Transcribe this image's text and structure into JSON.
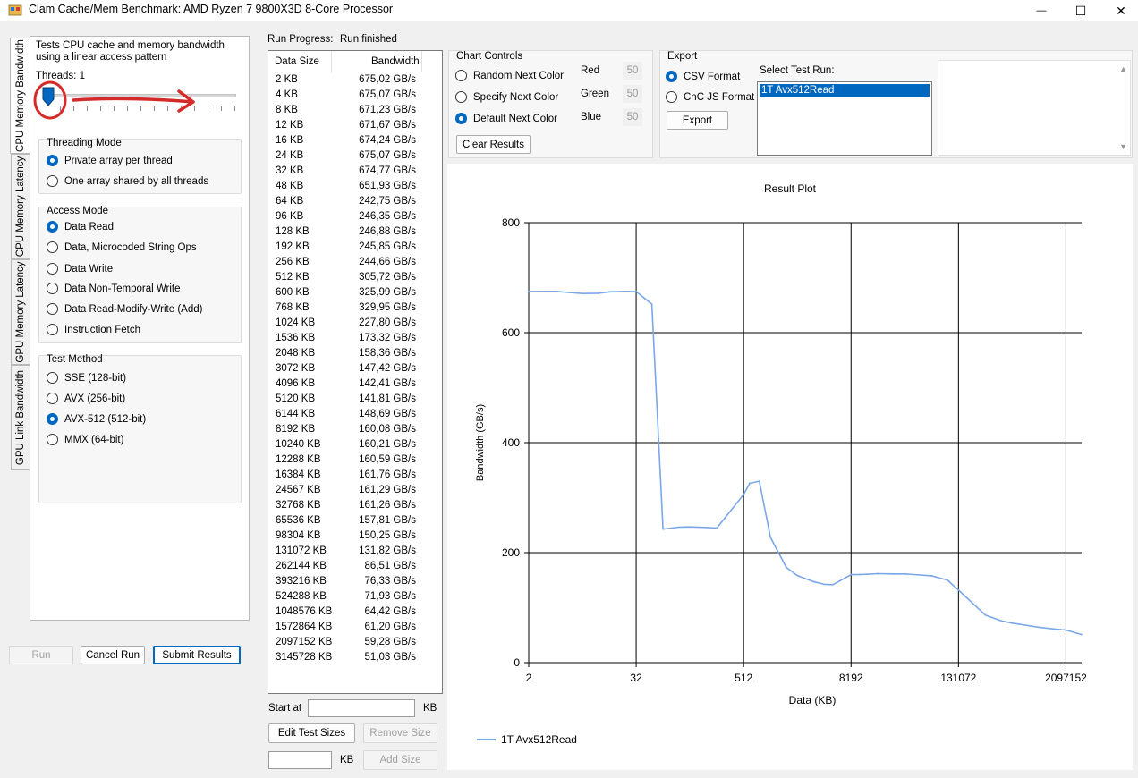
{
  "window": {
    "title": "Clam Cache/Mem Benchmark: AMD Ryzen 7 9800X3D 8-Core Processor",
    "minimize_glyph": "—",
    "maximize_glyph": "☐",
    "close_glyph": "✕"
  },
  "tabs": [
    {
      "label": "CPU Memory Bandwidth",
      "active": true
    },
    {
      "label": "CPU Memory Latency",
      "active": false
    },
    {
      "label": "GPU Memory Latency",
      "active": false
    },
    {
      "label": "GPU Link Bandwidth",
      "active": false
    }
  ],
  "settings": {
    "description": "Tests CPU cache and memory bandwidth using a linear access pattern",
    "threads_label": "Threads: 1",
    "threads_value": 1,
    "threading_mode": {
      "title": "Threading Mode",
      "options": [
        {
          "label": "Private array per thread",
          "selected": true
        },
        {
          "label": "One array shared by all threads",
          "selected": false
        }
      ]
    },
    "access_mode": {
      "title": "Access Mode",
      "options": [
        {
          "label": "Data Read",
          "selected": true
        },
        {
          "label": "Data, Microcoded String Ops",
          "selected": false
        },
        {
          "label": "Data Write",
          "selected": false
        },
        {
          "label": "Data Non-Temporal Write",
          "selected": false
        },
        {
          "label": "Data Read-Modify-Write (Add)",
          "selected": false
        },
        {
          "label": "Instruction Fetch",
          "selected": false
        }
      ]
    },
    "test_method": {
      "title": "Test Method",
      "options": [
        {
          "label": "SSE (128-bit)",
          "selected": false
        },
        {
          "label": "AVX (256-bit)",
          "selected": false
        },
        {
          "label": "AVX-512 (512-bit)",
          "selected": true
        },
        {
          "label": "MMX (64-bit)",
          "selected": false
        }
      ]
    }
  },
  "buttons": {
    "run": "Run",
    "cancel_run": "Cancel Run",
    "submit_results": "Submit Results",
    "edit_test_sizes": "Edit Test Sizes",
    "remove_size": "Remove Size",
    "add_size": "Add Size",
    "clear_results": "Clear Results",
    "export": "Export"
  },
  "progress": {
    "label": "Run Progress:",
    "status": "Run finished"
  },
  "results": {
    "headers": [
      "Data Size",
      "Bandwidth"
    ],
    "rows": [
      [
        "2 KB",
        "675,02 GB/s"
      ],
      [
        "4 KB",
        "675,07 GB/s"
      ],
      [
        "8 KB",
        "671,23 GB/s"
      ],
      [
        "12 KB",
        "671,67 GB/s"
      ],
      [
        "16 KB",
        "674,24 GB/s"
      ],
      [
        "24 KB",
        "675,07 GB/s"
      ],
      [
        "32 KB",
        "674,77 GB/s"
      ],
      [
        "48 KB",
        "651,93 GB/s"
      ],
      [
        "64 KB",
        "242,75 GB/s"
      ],
      [
        "96 KB",
        "246,35 GB/s"
      ],
      [
        "128 KB",
        "246,88 GB/s"
      ],
      [
        "192 KB",
        "245,85 GB/s"
      ],
      [
        "256 KB",
        "244,66 GB/s"
      ],
      [
        "512 KB",
        "305,72 GB/s"
      ],
      [
        "600 KB",
        "325,99 GB/s"
      ],
      [
        "768 KB",
        "329,95 GB/s"
      ],
      [
        "1024 KB",
        "227,80 GB/s"
      ],
      [
        "1536 KB",
        "173,32 GB/s"
      ],
      [
        "2048 KB",
        "158,36 GB/s"
      ],
      [
        "3072 KB",
        "147,42 GB/s"
      ],
      [
        "4096 KB",
        "142,41 GB/s"
      ],
      [
        "5120 KB",
        "141,81 GB/s"
      ],
      [
        "6144 KB",
        "148,69 GB/s"
      ],
      [
        "8192 KB",
        "160,08 GB/s"
      ],
      [
        "10240 KB",
        "160,21 GB/s"
      ],
      [
        "12288 KB",
        "160,59 GB/s"
      ],
      [
        "16384 KB",
        "161,76 GB/s"
      ],
      [
        "24567 KB",
        "161,29 GB/s"
      ],
      [
        "32768 KB",
        "161,26 GB/s"
      ],
      [
        "65536 KB",
        "157,81 GB/s"
      ],
      [
        "98304 KB",
        "150,25 GB/s"
      ],
      [
        "131072 KB",
        "131,82 GB/s"
      ],
      [
        "262144 KB",
        "86,51 GB/s"
      ],
      [
        "393216 KB",
        "76,33 GB/s"
      ],
      [
        "524288 KB",
        "71,93 GB/s"
      ],
      [
        "1048576 KB",
        "64,42 GB/s"
      ],
      [
        "1572864 KB",
        "61,20 GB/s"
      ],
      [
        "2097152 KB",
        "59,28 GB/s"
      ],
      [
        "3145728 KB",
        "51,03 GB/s"
      ]
    ]
  },
  "size_controls": {
    "start_at_label": "Start at",
    "start_at_value": "",
    "unit_label": "KB",
    "add_size_value": ""
  },
  "chart_controls": {
    "title": "Chart Controls",
    "options": [
      {
        "label": "Random Next Color",
        "selected": false
      },
      {
        "label": "Specify Next Color",
        "selected": false
      },
      {
        "label": "Default Next Color",
        "selected": true
      }
    ],
    "red_label": "Red",
    "red_value": "50",
    "green_label": "Green",
    "green_value": "50",
    "blue_label": "Blue",
    "blue_value": "50"
  },
  "export": {
    "title": "Export",
    "options": [
      {
        "label": "CSV Format",
        "selected": true
      },
      {
        "label": "CnC JS Format",
        "selected": false
      }
    ],
    "select_run_label": "Select Test Run:",
    "runs": [
      "1T Avx512Read"
    ],
    "selected_run": "1T Avx512Read",
    "output_text": ""
  },
  "annotation": {
    "color": "#d42a2a"
  },
  "chart_data": {
    "type": "line",
    "title": "Result Plot",
    "xlabel": "Data (KB)",
    "ylabel": "Bandwidth (GB/s)",
    "x_scale": "log2",
    "xlim": [
      2,
      3145728
    ],
    "ylim": [
      0,
      800
    ],
    "x_ticks": [
      2,
      32,
      512,
      8192,
      131072,
      2097152
    ],
    "x_tick_labels": [
      "2",
      "32",
      "512",
      "8192",
      "131072",
      "2097152"
    ],
    "y_ticks": [
      0,
      200,
      400,
      600,
      800
    ],
    "y_tick_labels": [
      "0",
      "200",
      "400",
      "600",
      "800"
    ],
    "grid": true,
    "legend_position": "bottom-left",
    "series": [
      {
        "name": "1T Avx512Read",
        "color": "#7aa7e8",
        "x": [
          2,
          4,
          8,
          12,
          16,
          24,
          32,
          48,
          64,
          96,
          128,
          192,
          256,
          512,
          600,
          768,
          1024,
          1536,
          2048,
          3072,
          4096,
          5120,
          6144,
          8192,
          10240,
          12288,
          16384,
          24567,
          32768,
          65536,
          98304,
          131072,
          262144,
          393216,
          524288,
          1048576,
          1572864,
          2097152,
          3145728
        ],
        "y": [
          675.02,
          675.07,
          671.23,
          671.67,
          674.24,
          675.07,
          674.77,
          651.93,
          242.75,
          246.35,
          246.88,
          245.85,
          244.66,
          305.72,
          325.99,
          329.95,
          227.8,
          173.32,
          158.36,
          147.42,
          142.41,
          141.81,
          148.69,
          160.08,
          160.21,
          160.59,
          161.76,
          161.29,
          161.26,
          157.81,
          150.25,
          131.82,
          86.51,
          76.33,
          71.93,
          64.42,
          61.2,
          59.28,
          51.03
        ]
      }
    ]
  }
}
